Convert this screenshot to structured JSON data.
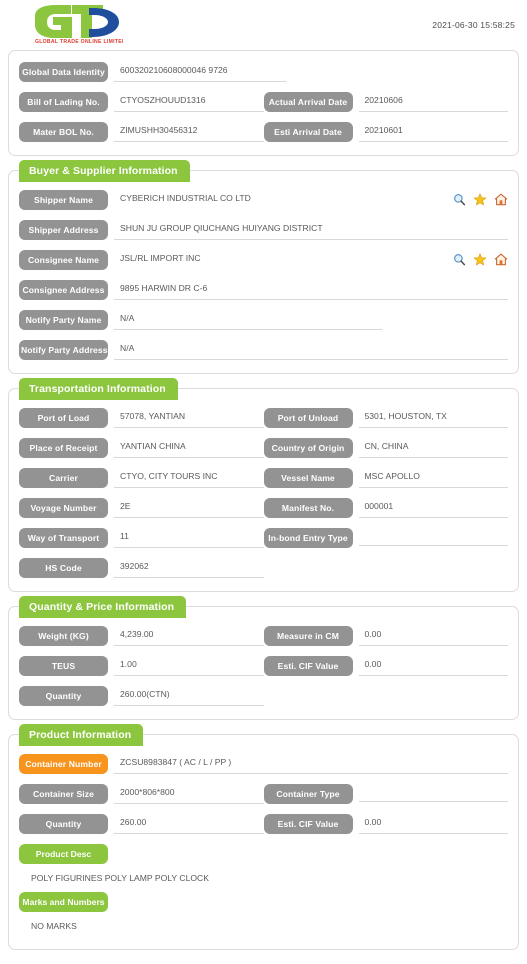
{
  "header": {
    "logo_text": "GTO",
    "logo_tagline": "GLOBAL TRADE ONLINE LIMITED",
    "timestamp": "2021-06-30 15:58:25"
  },
  "identity": {
    "fields": [
      {
        "label": "Global Data Identity",
        "value": "600320210608000046 9726"
      },
      {
        "label": "Bill of Lading No.",
        "value": "CTYOSZHOUUD1316"
      },
      {
        "label": "Actual Arrival Date",
        "value": "20210606"
      },
      {
        "label": "Mater BOL No.",
        "value": "ZIMUSHH30456312"
      },
      {
        "label": "Esti Arrival Date",
        "value": "20210601"
      }
    ]
  },
  "buyer_supplier": {
    "title": "Buyer & Supplier Information",
    "fields": [
      {
        "label": "Shipper Name",
        "value": "CYBERICH INDUSTRIAL CO LTD"
      },
      {
        "label": "Shipper Address",
        "value": "SHUN JU GROUP QIUCHANG HUIYANG DISTRICT"
      },
      {
        "label": "Consignee Name",
        "value": "JSL/RL IMPORT INC"
      },
      {
        "label": "Consignee Address",
        "value": "9895 HARWIN DR C-6"
      },
      {
        "label": "Notify Party Name",
        "value": "N/A"
      },
      {
        "label": "Notify Party Address",
        "value": "N/A"
      }
    ]
  },
  "transportation": {
    "title": "Transportation Information",
    "fields": [
      {
        "label": "Port of Load",
        "value": "57078, YANTIAN"
      },
      {
        "label": "Port of Unload",
        "value": "5301, HOUSTON, TX"
      },
      {
        "label": "Place of Receipt",
        "value": "YANTIAN CHINA"
      },
      {
        "label": "Country of Origin",
        "value": "CN, CHINA"
      },
      {
        "label": "Carrier",
        "value": "CTYO, CITY TOURS INC"
      },
      {
        "label": "Vessel Name",
        "value": "MSC APOLLO"
      },
      {
        "label": "Voyage Number",
        "value": "2E"
      },
      {
        "label": "Manifest No.",
        "value": "000001"
      },
      {
        "label": "Way of Transport",
        "value": "11"
      },
      {
        "label": "In-bond Entry Type",
        "value": ""
      },
      {
        "label": "HS Code",
        "value": "392062"
      }
    ]
  },
  "quantity_price": {
    "title": "Quantity & Price Information",
    "fields": [
      {
        "label": "Weight (KG)",
        "value": "4,239.00"
      },
      {
        "label": "Measure in CM",
        "value": "0.00"
      },
      {
        "label": "TEUS",
        "value": "1.00"
      },
      {
        "label": "Esti. CIF Value",
        "value": "0.00"
      },
      {
        "label": "Quantity",
        "value": "260.00(CTN)"
      }
    ]
  },
  "product": {
    "title": "Product Information",
    "fields": [
      {
        "label": "Container Number",
        "value": "ZCSU8983847 ( AC / L / PP )"
      },
      {
        "label": "Container Size",
        "value": "2000*806*800"
      },
      {
        "label": "Container Type",
        "value": ""
      },
      {
        "label": "Quantity",
        "value": "260.00"
      },
      {
        "label": "Esti. CIF Value",
        "value": "0.00"
      }
    ],
    "product_desc_label": "Product Desc",
    "product_desc_text": "POLY FIGURINES POLY LAMP POLY CLOCK",
    "marks_label": "Marks and Numbers",
    "marks_text": "NO MARKS"
  },
  "icons": {
    "search": "search-icon",
    "favorite": "star-icon",
    "home": "home-icon"
  },
  "colors": {
    "green": "#8cc63e",
    "gray": "#939393",
    "orange": "#f7941e",
    "logo_blue": "#1f4e9c"
  }
}
